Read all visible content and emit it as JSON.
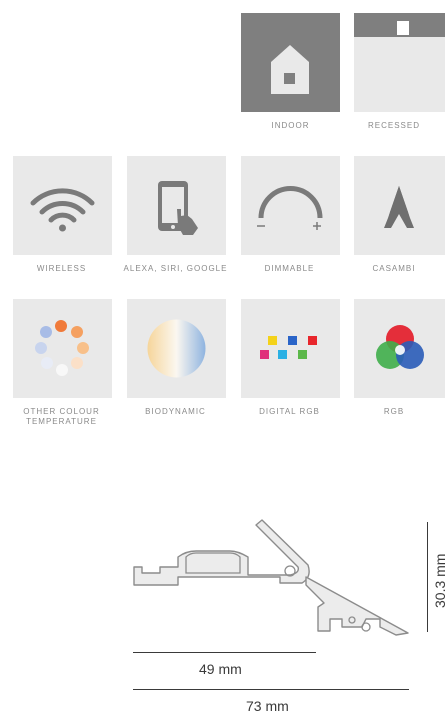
{
  "features": {
    "indoor": {
      "label": "INDOOR",
      "icon": "house-icon"
    },
    "recessed": {
      "label": "RECESSED",
      "icon": "recessed-icon"
    },
    "wireless": {
      "label": "WIRELESS",
      "icon": "wifi-icon"
    },
    "voice": {
      "label": "ALEXA, SIRI, GOOGLE",
      "icon": "smartphone-touch-icon"
    },
    "dimmable": {
      "label": "DIMMABLE",
      "icon": "dimmer-arc-icon"
    },
    "casambi": {
      "label": "CASAMBI",
      "icon": "casambi-icon"
    },
    "colour_temp": {
      "label": "OTHER COLOUR TEMPERATURE",
      "icon": "colour-temperature-dots-icon"
    },
    "biodynamic": {
      "label": "BIODYNAMIC",
      "icon": "biodynamic-gradient-icon"
    },
    "digital_rgb": {
      "label": "DIGITAL RGB",
      "icon": "digital-rgb-pixels-icon"
    },
    "rgb": {
      "label": "RGB",
      "icon": "rgb-circles-icon"
    }
  },
  "profile": {
    "icon": "profile-cross-section-drawing",
    "width_inner": "49 mm",
    "width_outer": "73 mm",
    "height": "30,3 mm"
  },
  "colors": {
    "tile_light": "#e9e9e9",
    "tile_dark": "#7f7f7f",
    "icon_gray": "#7a7a7a",
    "label_gray": "#8a8a8a"
  }
}
